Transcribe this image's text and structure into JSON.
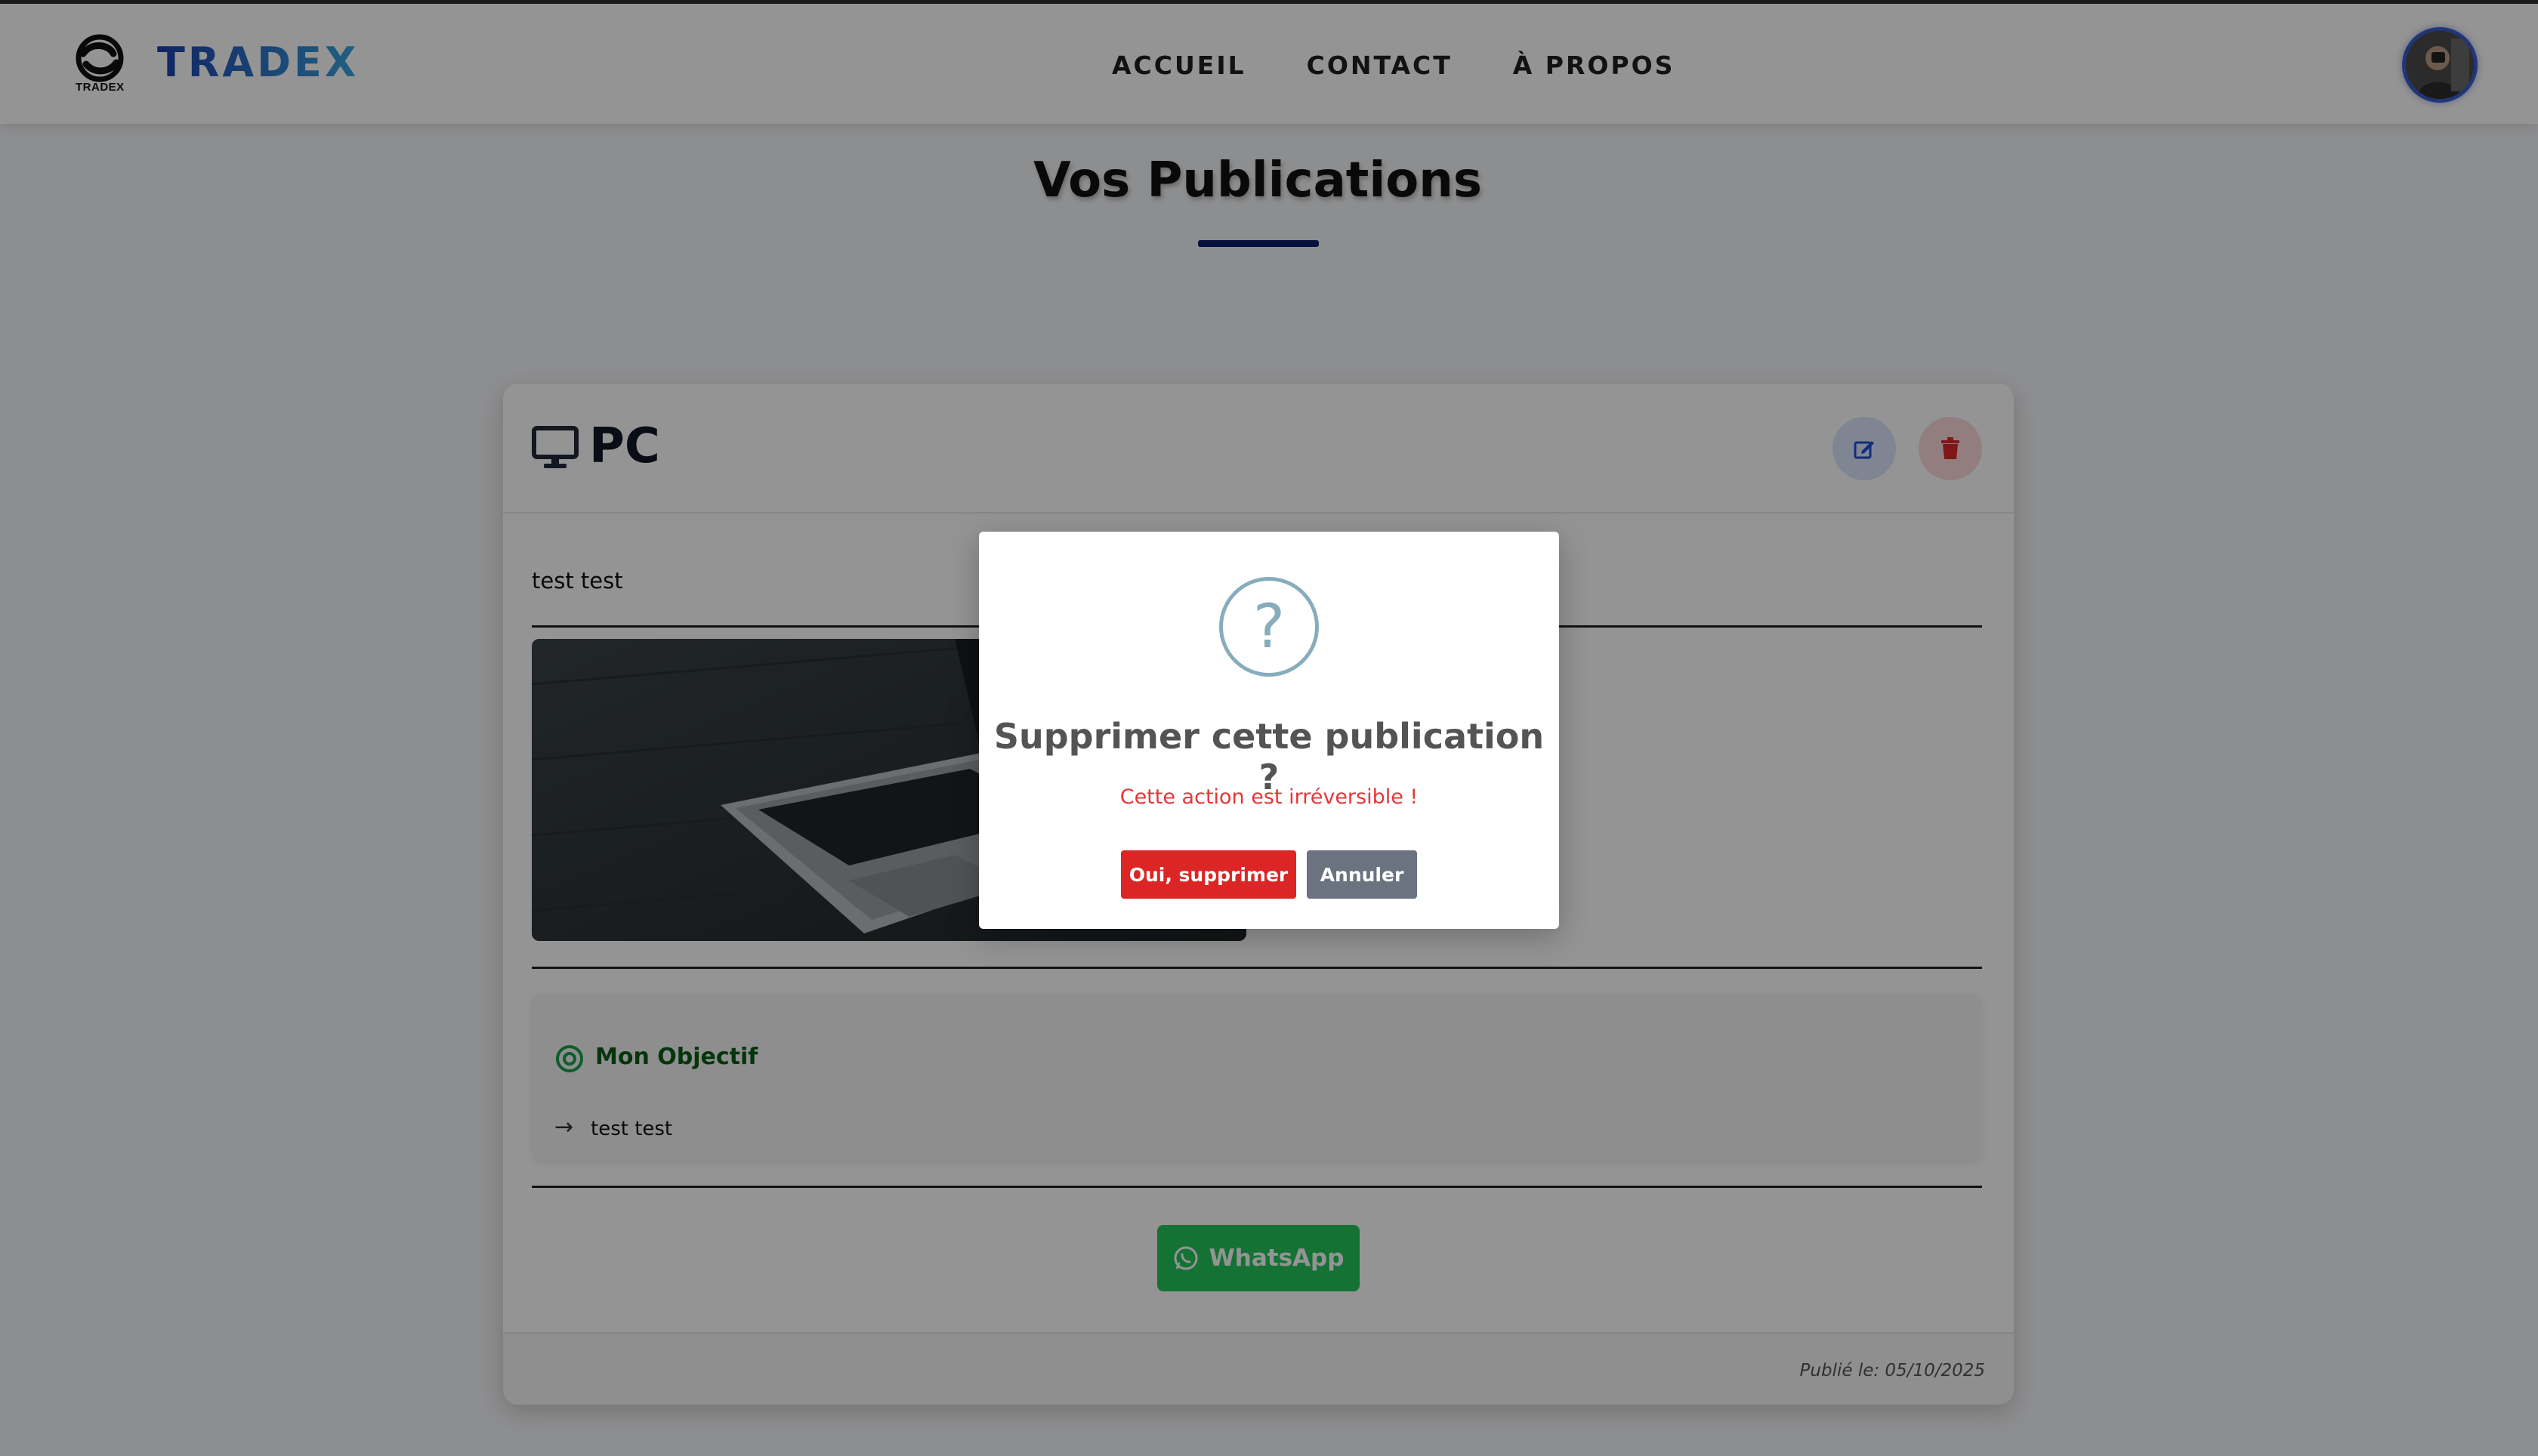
{
  "navbar": {
    "brand": "TRADEX",
    "logo_text": "TRADEX",
    "links": [
      "ACCUEIL",
      "CONTACT",
      "À PROPOS"
    ]
  },
  "page": {
    "title": "Vos Publications"
  },
  "publication": {
    "title": "PC",
    "description": "test test",
    "objective_title": "Mon Objectif",
    "objective_text": "test test",
    "whatsapp_label": "WhatsApp",
    "published_date": "Publié le: 05/10/2025"
  },
  "dialog": {
    "icon": "question-mark-icon",
    "title": "Supprimer cette publication ?",
    "text": "Cette action est irréversible !",
    "confirm_label": "Oui, supprimer",
    "cancel_label": "Annuler"
  },
  "colors": {
    "brand_gradient_start": "#1e40af",
    "brand_gradient_end": "#3aa6e0",
    "danger": "#dc2626",
    "whatsapp": "#25c45c",
    "objective": "#0a5c14"
  }
}
